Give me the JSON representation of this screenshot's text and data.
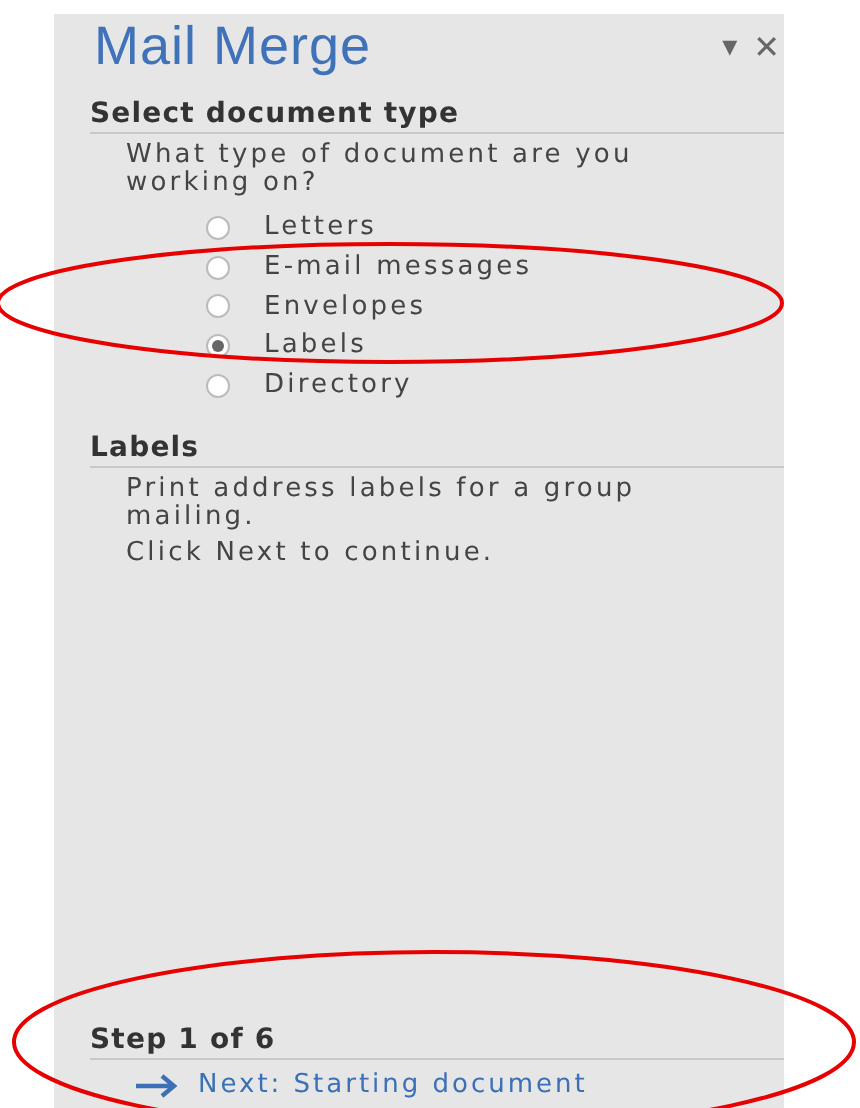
{
  "pane": {
    "title": "Mail Merge",
    "menu_icon": "▾",
    "close_icon": "✕"
  },
  "select": {
    "heading": "Select document type",
    "question": "What type of document are you working on?",
    "options": [
      {
        "label": "Letters",
        "selected": false
      },
      {
        "label": "E-mail messages",
        "selected": false
      },
      {
        "label": "Envelopes",
        "selected": false
      },
      {
        "label": "Labels",
        "selected": true
      },
      {
        "label": "Directory",
        "selected": false
      }
    ]
  },
  "info": {
    "heading": "Labels",
    "lines": [
      "Print address labels for a group mailing.",
      "Click Next to continue."
    ]
  },
  "footer": {
    "step": "Step 1 of 6",
    "next_link": "Next: Starting document"
  },
  "annotations": [
    {
      "kind": "ellipse",
      "color": "#e60000"
    },
    {
      "kind": "ellipse",
      "color": "#e60000"
    }
  ]
}
